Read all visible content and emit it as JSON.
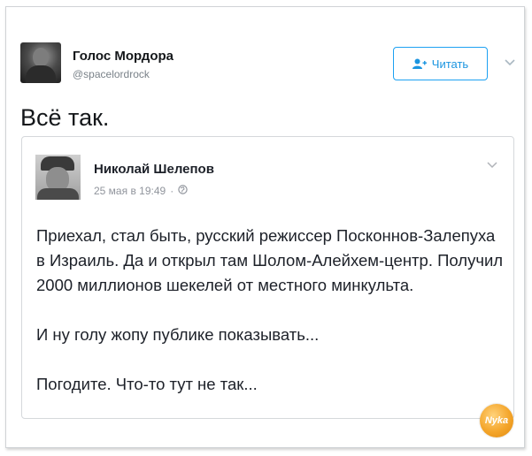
{
  "tweet": {
    "author_name": "Голос Мордора",
    "author_handle": "@spacelordrock",
    "follow_label": "Читать",
    "text": "Всё так."
  },
  "quoted_post": {
    "author_name": "Николай Шелепов",
    "date": "25 мая в 19:49",
    "separator": "·",
    "paragraphs": [
      "Приехал, стал быть, русский режиссер Посконнов-Залепуха в Израиль. Да и открыл там Шолом-Алейхем-центр. Получил 2000 миллионов шекелей от местного минкульта.",
      "И ну голу жопу публике показывать...",
      "Погодите. Что-то тут не так..."
    ]
  },
  "watermark": "Nyka",
  "colors": {
    "accent": "#1da1f2",
    "text": "#14171a",
    "muted": "#7a8289",
    "border": "#d5d8db",
    "watermark": "#f4a52a"
  },
  "icons": [
    "add-user-icon",
    "chevron-down-icon",
    "globe-icon"
  ]
}
